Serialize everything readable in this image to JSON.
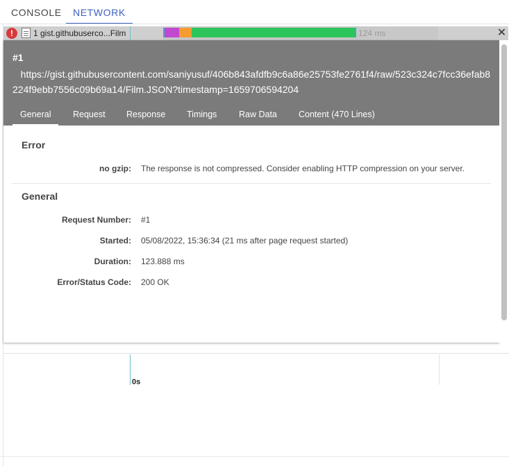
{
  "top_tabs": {
    "console": "CONSOLE",
    "network": "NETWORK"
  },
  "request_row": {
    "name": "1 gist.githubuserco...Film",
    "duration": "124 ms",
    "close": "✕"
  },
  "detail": {
    "request_number": "#1",
    "url": "https://gist.githubusercontent.com/saniyusuf/406b843afdfb9c6a86e25753fe2761f4/raw/523c324c7fcc36efab8224f9ebb7556c09b69a14/Film.JSON?timestamp=1659706594204",
    "tabs": [
      {
        "label": "General",
        "active": true
      },
      {
        "label": "Request"
      },
      {
        "label": "Response"
      },
      {
        "label": "Timings"
      },
      {
        "label": "Raw Data"
      },
      {
        "label": "Content (470 Lines)"
      }
    ],
    "error_section": {
      "title": "Error",
      "label": "no gzip:",
      "value": "The response is not compressed. Consider enabling HTTP compression on your server."
    },
    "general_section": {
      "title": "General",
      "rows": [
        {
          "label": "Request Number:",
          "value": "#1"
        },
        {
          "label": "Started:",
          "value": "05/08/2022, 15:36:34 (21 ms after page request started)"
        },
        {
          "label": "Duration:",
          "value": "123.888 ms"
        },
        {
          "label": "Error/Status Code:",
          "value": "200 OK"
        }
      ]
    }
  },
  "timeline": {
    "label": "0s"
  },
  "colors": {
    "accent": "#3f5fbf",
    "header_bg": "#7b7b7b",
    "error": "#d9393b",
    "dns": "#c348d1",
    "connect": "#f39c30",
    "download": "#2dc55a"
  },
  "icons": [
    "error-icon",
    "document-icon",
    "close-icon"
  ]
}
